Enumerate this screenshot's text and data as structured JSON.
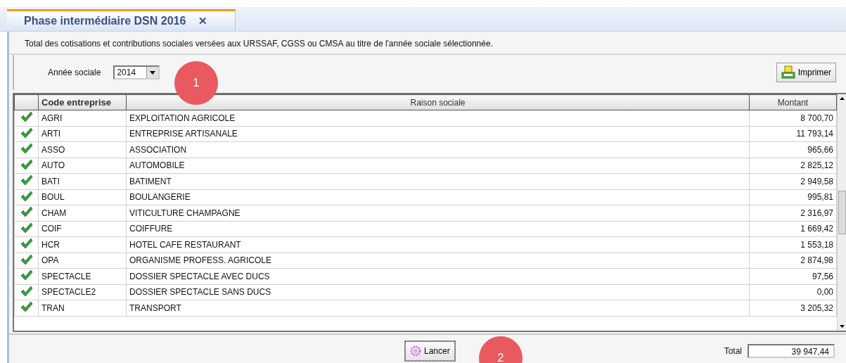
{
  "tab": {
    "title": "Phase intermédiaire DSN 2016",
    "close": "✕",
    "selected": true
  },
  "description": "Total des cotisations et contributions sociales versées aux URSSAF, CGSS ou CMSA au titre de l'année sociale sélectionnée.",
  "year_field": {
    "label": "Année sociale",
    "value": "2014"
  },
  "print_button": "Imprimer",
  "table": {
    "columns": [
      "Code entreprise",
      "Raison sociale",
      "Montant"
    ],
    "rows": [
      {
        "code": "AGRI",
        "name": "EXPLOITATION AGRICOLE",
        "amount": "8 700,70"
      },
      {
        "code": "ARTI",
        "name": "ENTREPRISE ARTISANALE",
        "amount": "11 793,14"
      },
      {
        "code": "ASSO",
        "name": "ASSOCIATION",
        "amount": "965,66"
      },
      {
        "code": "AUTO",
        "name": "AUTOMOBILE",
        "amount": "2 825,12"
      },
      {
        "code": "BATI",
        "name": "BATIMENT",
        "amount": "2 949,58"
      },
      {
        "code": "BOUL",
        "name": "BOULANGERIE",
        "amount": "995,81"
      },
      {
        "code": "CHAM",
        "name": "VITICULTURE CHAMPAGNE",
        "amount": "2 316,97"
      },
      {
        "code": "COIF",
        "name": "COIFFURE",
        "amount": "1 669,42"
      },
      {
        "code": "HCR",
        "name": "HOTEL CAFE RESTAURANT",
        "amount": "1 553,18"
      },
      {
        "code": "OPA",
        "name": "ORGANISME PROFESS. AGRICOLE",
        "amount": "2 874,98"
      },
      {
        "code": "SPECTACLE",
        "name": "DOSSIER SPECTACLE AVEC DUCS",
        "amount": "97,56"
      },
      {
        "code": "SPECTACLE2",
        "name": "DOSSIER SPECTACLE SANS DUCS",
        "amount": "0,00"
      },
      {
        "code": "TRAN",
        "name": "TRANSPORT",
        "amount": "3 205,32"
      }
    ]
  },
  "launch_button": "Lancer",
  "total": {
    "label": "Total",
    "value": "39 947,44"
  },
  "annotations": [
    "1",
    "2"
  ]
}
